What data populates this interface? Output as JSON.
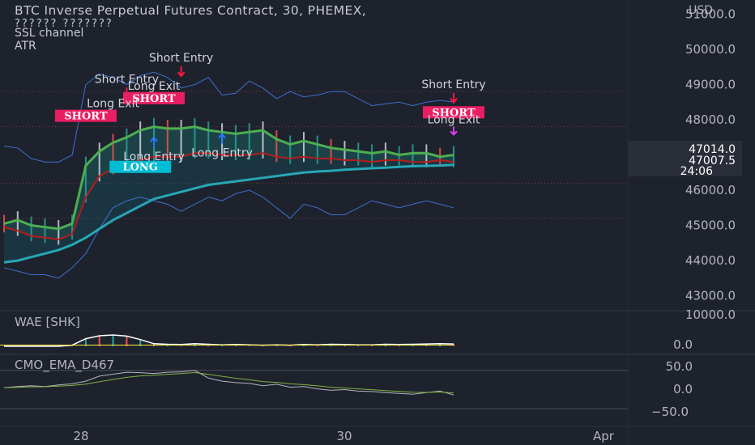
{
  "header": {
    "title": "BTC Inverse Perpetual Futures Contract, 30, PHEMEX,",
    "subtitle": "?????? ???????",
    "indicator_1": "SSL channel",
    "indicator_2": "ATR",
    "currency": "USD"
  },
  "price_axis": {
    "ticks": [
      "51000.0",
      "50000.0",
      "49000.0",
      "48000.0",
      "47000.0",
      "46000.0",
      "45000.0",
      "44000.0",
      "43000.0"
    ],
    "last_price": "47014.0",
    "second_price": "47007.5",
    "countdown": "24:06"
  },
  "time_axis": {
    "ticks": [
      "28",
      "30",
      "Apr"
    ]
  },
  "panes": {
    "wae": {
      "label": "WAE [SHK]",
      "ticks": [
        "10000.0",
        "0.0"
      ]
    },
    "cmo": {
      "label": "CMO_EMA_D467",
      "ticks": [
        "50.0",
        "0.0",
        "−50.0"
      ]
    }
  },
  "colors": {
    "background": "#1e222d",
    "bull": "#26a69a",
    "bear": "#ef5350",
    "ssl_green": "#4caf50",
    "ssl_red": "#b71c1c",
    "ema": "#26a7b5",
    "atr_band": "#3d6fd1",
    "short_label": "#e91e63",
    "long_label": "#00bcd4",
    "arrow_down": "#ff1744",
    "arrow_up": "#2979ff"
  },
  "chart_data": {
    "type": "line",
    "title": "BTC Inverse Perpetual Futures Contract, 30, PHEMEX,",
    "xlabel": "",
    "ylabel": "USD",
    "ylim": [
      42600,
      51400
    ],
    "x": [
      "27.5",
      "27.6",
      "27.7",
      "27.8",
      "27.9",
      "28.0",
      "28.1",
      "28.2",
      "28.3",
      "28.4",
      "28.5",
      "28.6",
      "28.7",
      "28.8",
      "28.9",
      "29.0",
      "29.1",
      "29.2",
      "29.3",
      "29.4",
      "29.5",
      "29.6",
      "29.7",
      "29.8",
      "29.9",
      "30.0",
      "30.1",
      "30.2",
      "30.3",
      "30.4",
      "30.5",
      "30.6",
      "30.7",
      "30.8"
    ],
    "series": [
      {
        "values": [
          45050,
          45150,
          45000,
          44950,
          44900,
          45050,
          46700,
          47100,
          47350,
          47500,
          47700,
          47800,
          47750,
          47750,
          47800,
          47700,
          47650,
          47600,
          47650,
          47700,
          47450,
          47300,
          47400,
          47300,
          47200,
          47150,
          47100,
          47050,
          47100,
          47000,
          47050,
          47050,
          46950,
          47000
        ]
      },
      {
        "values": [
          44950,
          44850,
          44700,
          44650,
          44600,
          44750,
          45800,
          46400,
          46600,
          46750,
          46850,
          46950,
          46950,
          46950,
          47050,
          47050,
          47000,
          47000,
          47000,
          47050,
          46950,
          46900,
          46950,
          46900,
          46900,
          46850,
          46850,
          46800,
          46850,
          46850,
          46800,
          46800,
          46850,
          46800
        ]
      },
      {
        "values": [
          43950,
          44000,
          44100,
          44200,
          44300,
          44450,
          44650,
          44900,
          45150,
          45350,
          45550,
          45750,
          45850,
          45950,
          46050,
          46150,
          46200,
          46250,
          46300,
          46350,
          46400,
          46450,
          46500,
          46530,
          46550,
          46580,
          46600,
          46620,
          46640,
          46660,
          46680,
          46690,
          46700,
          46720
        ]
      },
      {
        "values": [
          47250,
          47200,
          46900,
          46800,
          46800,
          47000,
          49000,
          49300,
          49200,
          49000,
          49250,
          49350,
          49200,
          48900,
          49000,
          49200,
          48700,
          48750,
          49100,
          48900,
          48600,
          48800,
          48650,
          48700,
          48800,
          48800,
          48600,
          48400,
          48450,
          48500,
          48400,
          48500,
          48550,
          48500
        ]
      },
      {
        "values": [
          43800,
          43700,
          43600,
          43600,
          43500,
          43800,
          44200,
          44900,
          45500,
          45700,
          45800,
          45700,
          45600,
          45400,
          45600,
          45800,
          45700,
          45900,
          46000,
          45800,
          45500,
          45200,
          45600,
          45500,
          45300,
          45300,
          45500,
          45700,
          45600,
          45500,
          45600,
          45700,
          45600,
          45500
        ]
      }
    ],
    "signals": [
      {
        "text": "Short Entry",
        "x": "28.8",
        "y": 49650,
        "kind": "short_entry"
      },
      {
        "text": "Short Entry",
        "x": "28.4",
        "y": 49050,
        "kind": "short_entry"
      },
      {
        "text": "Long Exit",
        "x": "28.6",
        "y": 48850,
        "kind": "long_exit"
      },
      {
        "text": "SHORT",
        "x": "28.6",
        "y": 48600,
        "kind": "short_badge"
      },
      {
        "text": "Long Exit",
        "x": "28.3",
        "y": 48350,
        "kind": "long_exit"
      },
      {
        "text": "SHORT",
        "x": "28.1",
        "y": 48100,
        "kind": "short_badge"
      },
      {
        "text": "Long Entry",
        "x": "28.6",
        "y": 46850,
        "kind": "long_entry"
      },
      {
        "text": "Long Entry",
        "x": "29.1",
        "y": 46950,
        "kind": "long_entry"
      },
      {
        "text": "LONG",
        "x": "28.5",
        "y": 46650,
        "kind": "long_badge"
      },
      {
        "text": "Short Entry",
        "x": "30.8",
        "y": 48900,
        "kind": "short_entry"
      },
      {
        "text": "SHORT",
        "x": "30.8",
        "y": 48200,
        "kind": "short_badge"
      },
      {
        "text": "Long Exit",
        "x": "30.8",
        "y": 47900,
        "kind": "long_exit"
      }
    ],
    "wae": {
      "ylim": [
        0,
        10000
      ],
      "values": [
        0,
        0,
        0,
        0,
        0,
        400,
        2600,
        3600,
        3900,
        3500,
        2300,
        900,
        700,
        600,
        900,
        700,
        500,
        600,
        500,
        400,
        500,
        400,
        600,
        500,
        700,
        600,
        500,
        500,
        700,
        600,
        700,
        800,
        900,
        800
      ]
    },
    "cmo": {
      "ylim": [
        -60,
        60
      ],
      "values": [
        5,
        8,
        10,
        8,
        12,
        15,
        22,
        35,
        40,
        45,
        44,
        42,
        45,
        46,
        50,
        30,
        22,
        18,
        16,
        10,
        14,
        6,
        8,
        2,
        -2,
        0,
        -4,
        -5,
        -8,
        -10,
        -12,
        -8,
        -4,
        -14
      ]
    }
  }
}
